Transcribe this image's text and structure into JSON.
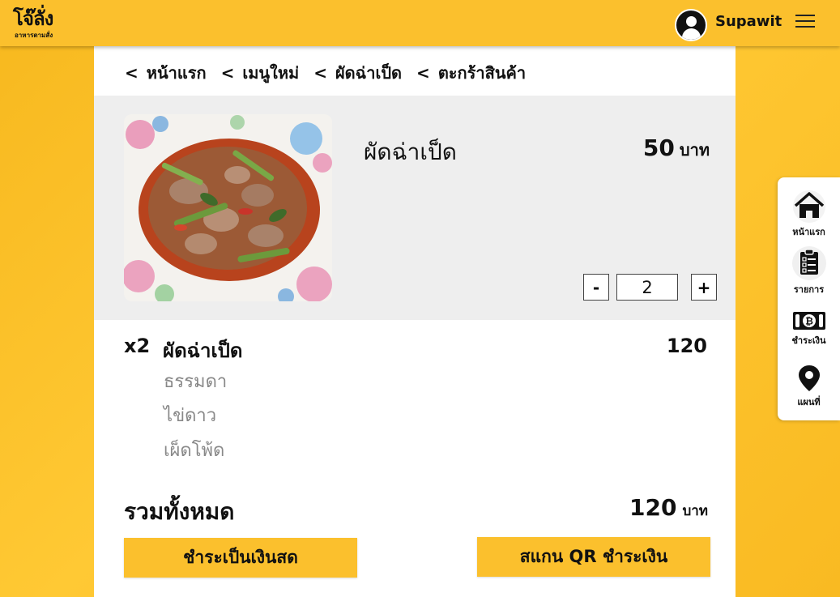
{
  "header": {
    "logo_main": "โจ๊ลั่ง",
    "logo_sub": "อาหารตามสั่ง",
    "username": "Supawit"
  },
  "breadcrumb": [
    {
      "label": "หน้าแรก"
    },
    {
      "label": "เมนูใหม่"
    },
    {
      "label": "ผัดฉ่าเป็ด"
    },
    {
      "label": "ตะกร้าสินค้า"
    }
  ],
  "breadcrumb_separator": "<",
  "product": {
    "name": "ผัดฉ่าเป็ด",
    "price": "50",
    "price_unit": "บาท",
    "quantity": "2",
    "minus_label": "-",
    "plus_label": "+"
  },
  "order": {
    "qty_label": "x2",
    "item_name": "ผัดฉ่าเป็ด",
    "item_total": "120",
    "options": [
      "ธรรมดา",
      "ไข่ดาว",
      "เผ็ดโพ้ด"
    ]
  },
  "summary": {
    "label": "รวมทั้งหมด",
    "total": "120",
    "unit": "บาท"
  },
  "actions": {
    "cash_label": "ชำระเป็นเงินสด",
    "qr_label": "สแกน QR ชำระเงิน"
  },
  "sidenav": [
    {
      "label": "หน้าแรก",
      "icon": "home-icon"
    },
    {
      "label": "รายการ",
      "icon": "clipboard-icon"
    },
    {
      "label": "ชำระเงิน",
      "icon": "bitcoin-payment-icon"
    },
    {
      "label": "แผนที่",
      "icon": "map-pin-icon"
    }
  ],
  "colors": {
    "brand": "#FBC02D",
    "panel_grey": "#EEEEEE",
    "option_text": "#888888"
  }
}
